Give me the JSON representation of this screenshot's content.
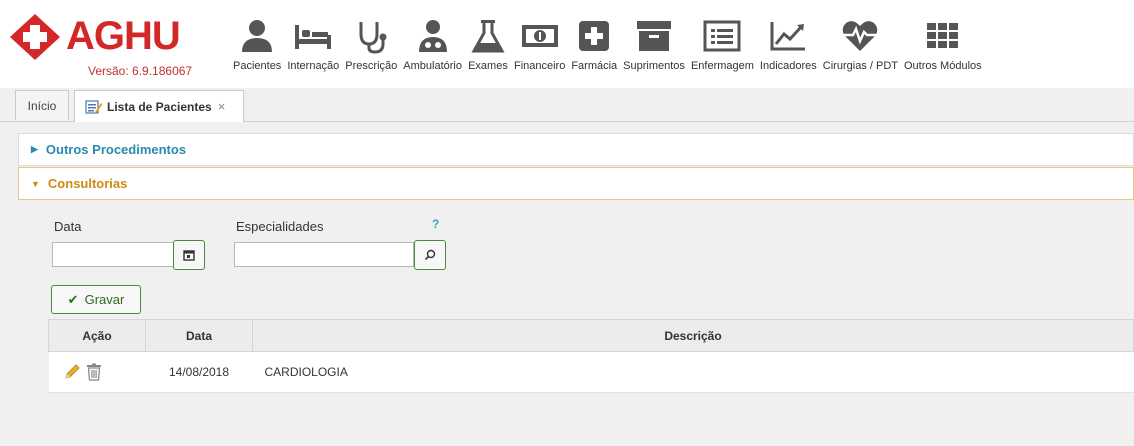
{
  "app": {
    "logo_text": "AGHU",
    "version": "Versão: 6.9.186067"
  },
  "modules": [
    {
      "label": "Pacientes",
      "icon": "user-icon"
    },
    {
      "label": "Internação",
      "icon": "bed-icon"
    },
    {
      "label": "Prescrição",
      "icon": "stethoscope-icon"
    },
    {
      "label": "Ambulatório",
      "icon": "doctor-icon"
    },
    {
      "label": "Exames",
      "icon": "flask-icon"
    },
    {
      "label": "Financeiro",
      "icon": "money-icon"
    },
    {
      "label": "Farmácia",
      "icon": "plus-box-icon"
    },
    {
      "label": "Suprimentos",
      "icon": "archive-icon"
    },
    {
      "label": "Enfermagem",
      "icon": "list-icon"
    },
    {
      "label": "Indicadores",
      "icon": "chart-line-icon"
    },
    {
      "label": "Cirurgias / PDT",
      "icon": "heart-pulse-icon"
    },
    {
      "label": "Outros Módulos",
      "icon": "grid-icon"
    }
  ],
  "tabs": {
    "home": "Início",
    "active": "Lista de Pacientes",
    "close": "×"
  },
  "accordion": {
    "outros_label": "Outros Procedimentos",
    "consultorias_label": "Consultorias"
  },
  "form": {
    "data_label": "Data",
    "data_value": "",
    "especialidades_label": "Especialidades",
    "especialidades_value": "",
    "help": "?",
    "gravar_label": "Gravar"
  },
  "table": {
    "headers": {
      "acao": "Ação",
      "data": "Data",
      "descricao": "Descrição"
    },
    "rows": [
      {
        "data": "14/08/2018",
        "descricao": "CARDIOLOGIA"
      }
    ]
  },
  "colors": {
    "brand": "#d32828",
    "accent_blue": "#2a8ab0",
    "accent_orange": "#d08a10",
    "button_green": "#4a8a3c"
  }
}
